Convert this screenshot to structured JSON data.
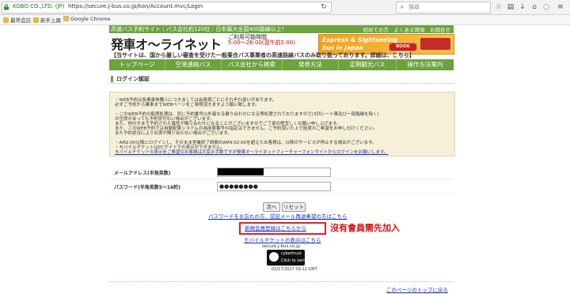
{
  "browser": {
    "site_identity": "KOBO CO.,LTD. (JP)",
    "url": "https://secure.j-bus.co.jp/kon/Account.mvc/Login",
    "search_placeholder": "搜尋",
    "bookmarks": [
      "最常造訪",
      "新手上路",
      "Google Chrome"
    ]
  },
  "header": {
    "top_bar": "高速バス予約サイト｜バス会社約120社｜日本最大全国400路線以上！",
    "top_links": "初めての方　よくある質問　お問合せ",
    "logo": "発車オ〜ライネット",
    "hours_label": "ご利用可能時間",
    "hours": "5:00〜26:00(翌午前2:00)",
    "banner_line1": "Express & Sightseeing",
    "banner_line2": "bus in Japan",
    "banner_button": "BOOK NOW!",
    "tagline": "【当サイトは、国から厳しい審査を受けた一般乗合バス事業者の高速路線バスのみ取り扱っております。詳細は、こちら】"
  },
  "nav": [
    "トップページ",
    "空港連絡バス",
    "バス会社から検索",
    "発券方法",
    "定期観光バス",
    "操作方法案内"
  ],
  "login": {
    "heading": "ログイン認証",
    "notice_lines": [
      "・WEB予約は各乗車券購入につきましては会員様ごとにそれぞれ違いがあります。",
      "必ずご予約から乗車までWEBページをご参照頂きますよう願い致します。",
      "",
      "・このWEB予約の配席処理は、同じ予約番号以外異なる乗り合わせになる等処理されておりますので(3列シート車及び一部路線を除く)",
      "の空席があっても予約受付ない場合がございます。",
      "また、他の方まで予約された異性が隣り合わせになることがございますのでご了承の程宜しくお願い申し上げます。",
      "また、このWEB予約では自動配車システムの為座席番号の指定はできません。ご予約頂いた上で座席のご希望をお申し付けください。",
      "また予約状況によりお席が隣り合わない場合がございます。",
      "",
      "・AM2:00以降にログインし、そのまま営業終了時間のAM4:02:00を超えたお客様は、以降のサービスが停止する場合がございます。",
      "・モバイルチケットはPCサイトでの表示ができません。",
      "モバイルチケットの表示をご希望のお客様は大変お手数ですが発車オ〜ライネットフィーチャーフォンサイトからログインをお願いします。"
    ],
    "email_label": "メールアドレス(半角英数)",
    "password_label": "パスワード(半角英数5〜16桁)",
    "password_value": "●●●●●●●●",
    "next_button": "次へ",
    "reset_button": "リセット",
    "forgot_link": "パスワードをお忘れの方、認証メール再送希望の方はこちら",
    "register_link": "新規会員登録はこちらから",
    "mobile_link": "モバイルチケットの表示はこちら",
    "seal_text": "secure.j-bus.co.jp",
    "seal_brand": "cybertrust",
    "seal_sub": "Click to verify",
    "seal_date": "02/17/2017 09:12 GMT",
    "page_top": "このページのトップに戻る"
  },
  "annotation": "沒有會員需先加入",
  "colors": {
    "brand_green": "#6ca33d",
    "annotation_red": "#e01010"
  }
}
